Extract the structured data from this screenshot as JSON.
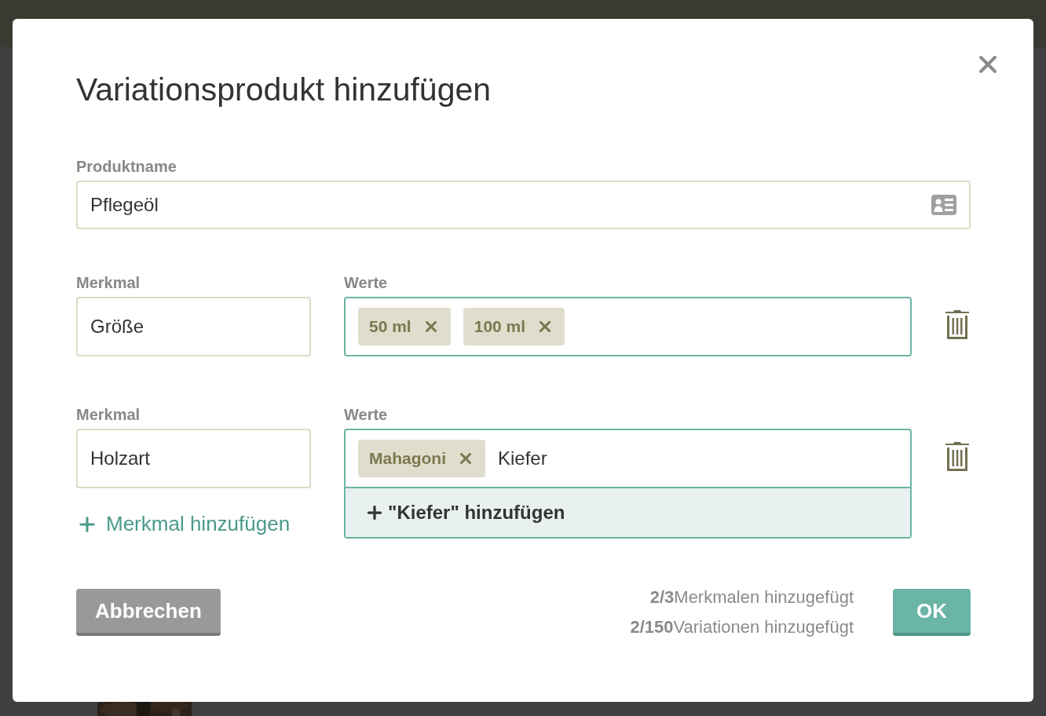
{
  "dialog": {
    "title": "Variationsprodukt hinzufügen",
    "product_name": {
      "label": "Produktname",
      "value": "Pflegeöl"
    },
    "attributes": [
      {
        "label": "Merkmal",
        "value": "Größe",
        "values_label": "Werte",
        "tags": [
          "50 ml",
          "100 ml"
        ]
      },
      {
        "label": "Merkmal",
        "value": "Holzart",
        "values_label": "Werte",
        "tags": [
          "Mahagoni"
        ],
        "typed": "Kiefer",
        "suggestion": "\"Kiefer\" hinzufügen"
      }
    ],
    "add_attribute": "Merkmal hinzufügen",
    "cancel": "Abbrechen",
    "stats": [
      "**2/3**Merkmalen hinzugefügt",
      "**2/150**Variationen hinzugefügt"
    ],
    "ok": "OK"
  }
}
